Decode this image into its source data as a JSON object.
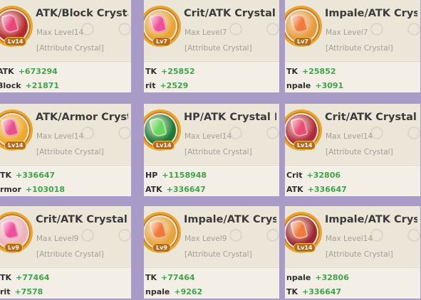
{
  "cards": [
    {
      "title": "ATK/Block Crystal",
      "max_level": "Max Level14",
      "attribute": "[Attribute Crystal]",
      "badge_level": "Lv14",
      "core_color": "#b7282c",
      "gem_color": "#e8477a",
      "stats": [
        {
          "name": "ATK",
          "value": "+673294"
        },
        {
          "name": "Block",
          "value": "+21871"
        }
      ]
    },
    {
      "title": "Crit/ATK Crystal",
      "max_level": "Max Level7",
      "attribute": "[Attribute Crystal]",
      "badge_level": "Lv7",
      "core_color": "#e8a533",
      "gem_color": "#ef4f9b",
      "stats": [
        {
          "name": "TK",
          "value": "+25852"
        },
        {
          "name": "rit",
          "value": "+2529"
        }
      ]
    },
    {
      "title": "Impale/ATK Crysta",
      "max_level": "Max Level7",
      "attribute": "[Attribute Crystal]",
      "badge_level": "Lv7",
      "core_color": "#e79a3a",
      "gem_color": "#f07a3b",
      "stats": [
        {
          "name": "TK",
          "value": "+25852"
        },
        {
          "name": "npale",
          "value": "+3091"
        }
      ]
    },
    {
      "title": "ATK/Armor Cryst",
      "max_level": "Max Level14",
      "attribute": "[Attribute Crystal]",
      "badge_level": "Lv14",
      "core_color": "#efa929",
      "gem_color": "#e7508c",
      "stats": [
        {
          "name": "TK",
          "value": "+336647"
        },
        {
          "name": "rmor",
          "value": "+103018"
        }
      ]
    },
    {
      "title": "HP/ATK Crystal I",
      "max_level": "Max Level14",
      "attribute": "[Attribute Crystal]",
      "badge_level": "Lv14",
      "core_color": "#1f7b34",
      "gem_color": "#67d65a",
      "stats": [
        {
          "name": "HP",
          "value": "+1158948"
        },
        {
          "name": "ATK",
          "value": "+336647"
        }
      ]
    },
    {
      "title": "Crit/ATK Crystal",
      "max_level": "Max Level14",
      "attribute": "[Attribute Crystal]",
      "badge_level": "Lv14",
      "core_color": "#b22a39",
      "gem_color": "#e74c73",
      "stats": [
        {
          "name": "Crit",
          "value": "+32806"
        },
        {
          "name": "ATK",
          "value": "+336647"
        }
      ]
    },
    {
      "title": "Crit/ATK Crystal",
      "max_level": "Max Level9",
      "attribute": "[Attribute Crystal]",
      "badge_level": "Lv9",
      "core_color": "#f0b1bd",
      "gem_color": "#ef4f9b",
      "stats": [
        {
          "name": "TK",
          "value": "+77464"
        },
        {
          "name": "rit",
          "value": "+7578"
        }
      ]
    },
    {
      "title": "Impale/ATK Crystal",
      "max_level": "Max Level9",
      "attribute": "[Attribute Crystal]",
      "badge_level": "Lv9",
      "core_color": "#e8a33a",
      "gem_color": "#f07a3b",
      "stats": [
        {
          "name": "TK",
          "value": "+77464"
        },
        {
          "name": "npale",
          "value": "+9262"
        }
      ]
    },
    {
      "title": "Impale/ATK Crystal",
      "max_level": "Max Level14",
      "attribute": "[Attribute Crystal]",
      "badge_level": "Lv14",
      "core_color": "#9f2630",
      "gem_color": "#f07a3b",
      "stats": [
        {
          "name": "npale",
          "value": "+32806"
        },
        {
          "name": "TK",
          "value": "+336647"
        }
      ]
    }
  ]
}
